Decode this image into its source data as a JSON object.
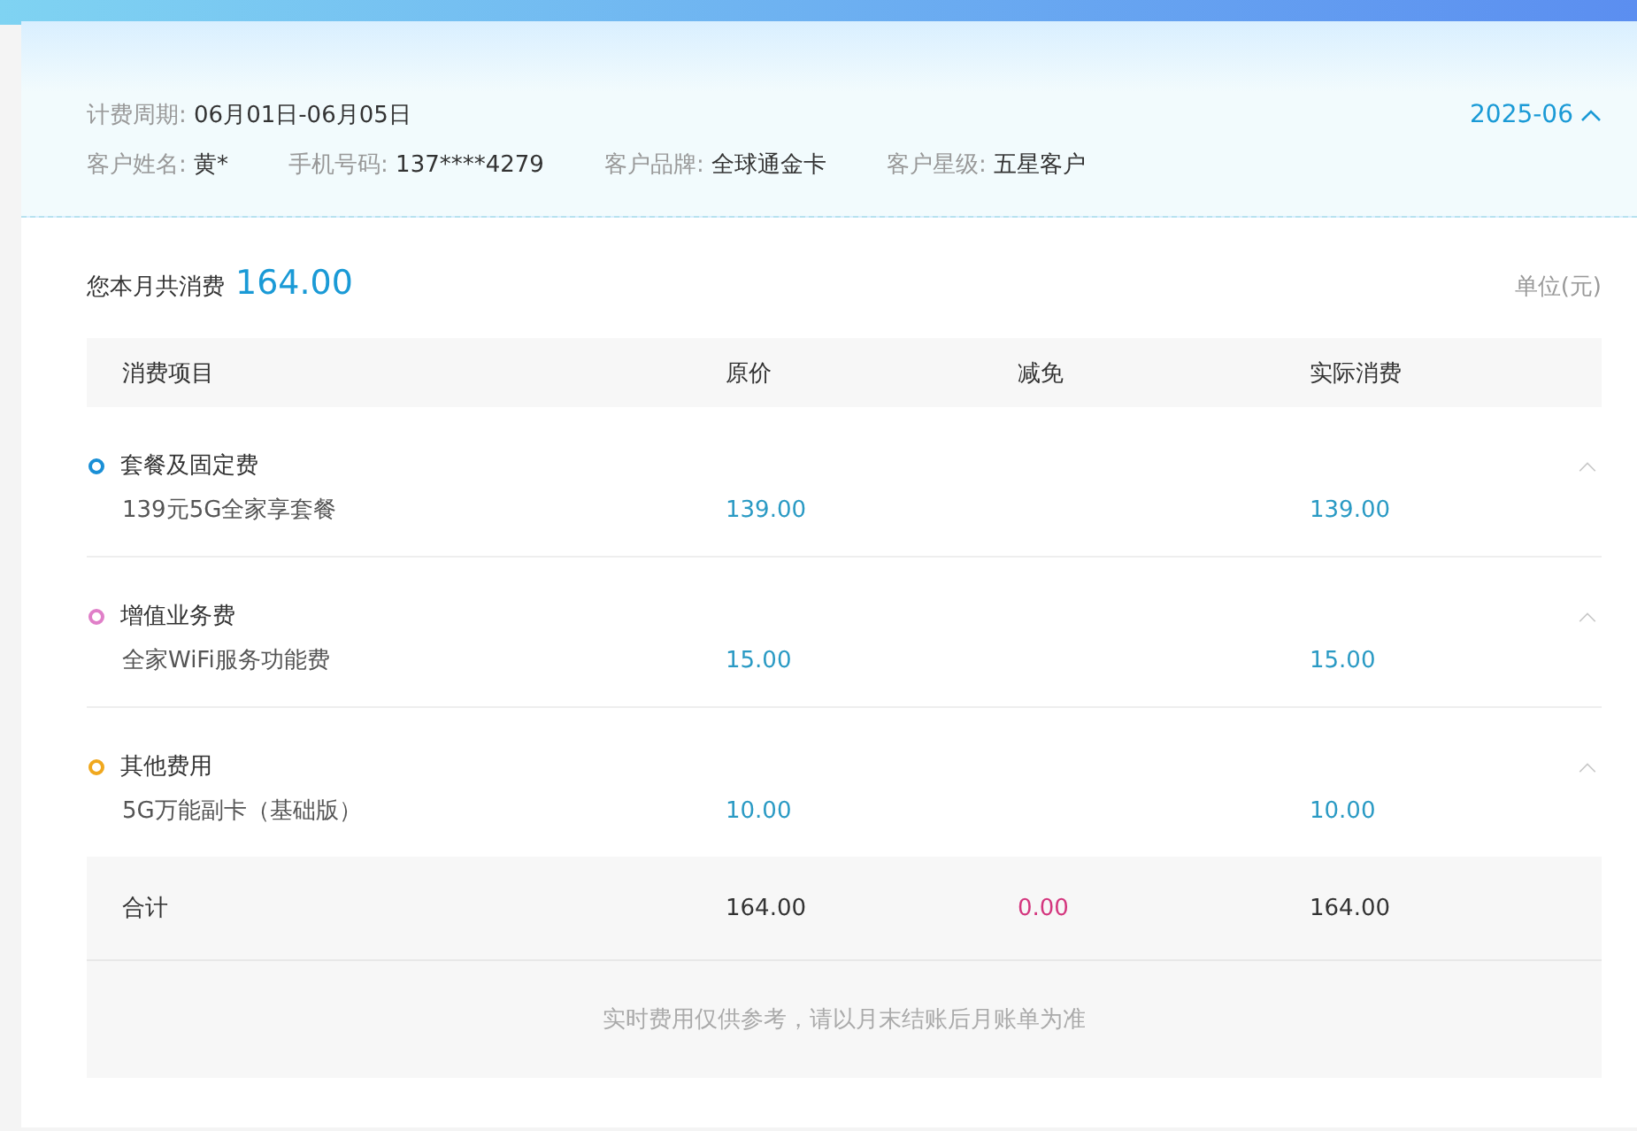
{
  "billing_period": {
    "label": "计费周期:",
    "value": "06月01日-06月05日"
  },
  "month_picker": {
    "value": "2025-06",
    "expanded": true
  },
  "customer_info": [
    {
      "label": "客户姓名:",
      "value": "黄*"
    },
    {
      "label": "手机号码:",
      "value": "137****4279"
    },
    {
      "label": "客户品牌:",
      "value": "全球通金卡"
    },
    {
      "label": "客户星级:",
      "value": "五星客户"
    }
  ],
  "total_summary": {
    "label": "您本月共消费",
    "amount": "164.00",
    "unit": "单位(元)"
  },
  "table": {
    "columns": [
      "消费项目",
      "原价",
      "减免",
      "实际消费"
    ],
    "groups": [
      {
        "name": "套餐及固定费",
        "color": "#1a8fd6",
        "expanded": true,
        "items": [
          {
            "name": "139元5G全家享套餐",
            "price": "139.00",
            "actual": "139.00"
          }
        ]
      },
      {
        "name": "增值业务费",
        "color": "#e07fc8",
        "expanded": true,
        "items": [
          {
            "name": "全家WiFi服务功能费",
            "price": "15.00",
            "actual": "15.00"
          }
        ]
      },
      {
        "name": "其他费用",
        "color": "#f0a81e",
        "expanded": true,
        "items": [
          {
            "name": "5G万能副卡（基础版）",
            "price": "10.00",
            "actual": "10.00"
          }
        ]
      }
    ],
    "total_row": {
      "label": "合计",
      "price": "164.00",
      "discount": "0.00",
      "actual": "164.00"
    }
  },
  "footnote": "实时费用仅供参考，请以月末结账后月账单为准"
}
